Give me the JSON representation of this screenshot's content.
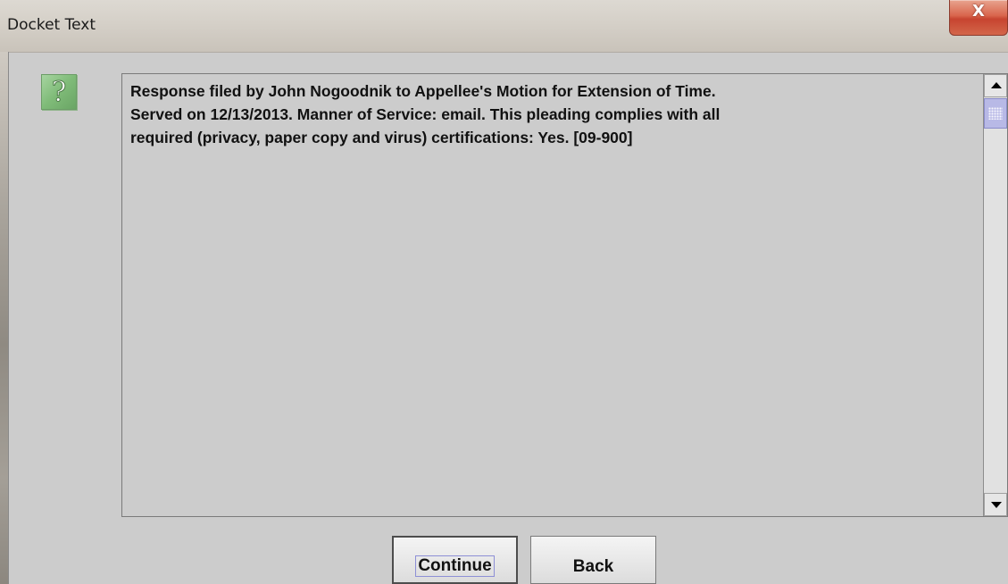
{
  "window": {
    "title": "Docket Text",
    "close_label": "X"
  },
  "dialog": {
    "icon": "question-icon",
    "icon_glyph": "?",
    "message": "Response filed by John Nogoodnik to Appellee's Motion for Extension of Time.\nServed on 12/13/2013. Manner of Service: email. This pleading complies with all\nrequired (privacy, paper copy and virus) certifications: Yes. [09-900]"
  },
  "buttons": {
    "continue_label": "Continue",
    "back_label": "Back"
  },
  "colors": {
    "background": "#cccccc",
    "icon_green": "#7fbb78",
    "close_red": "#c74430",
    "scroll_thumb": "#b8b9e6"
  }
}
